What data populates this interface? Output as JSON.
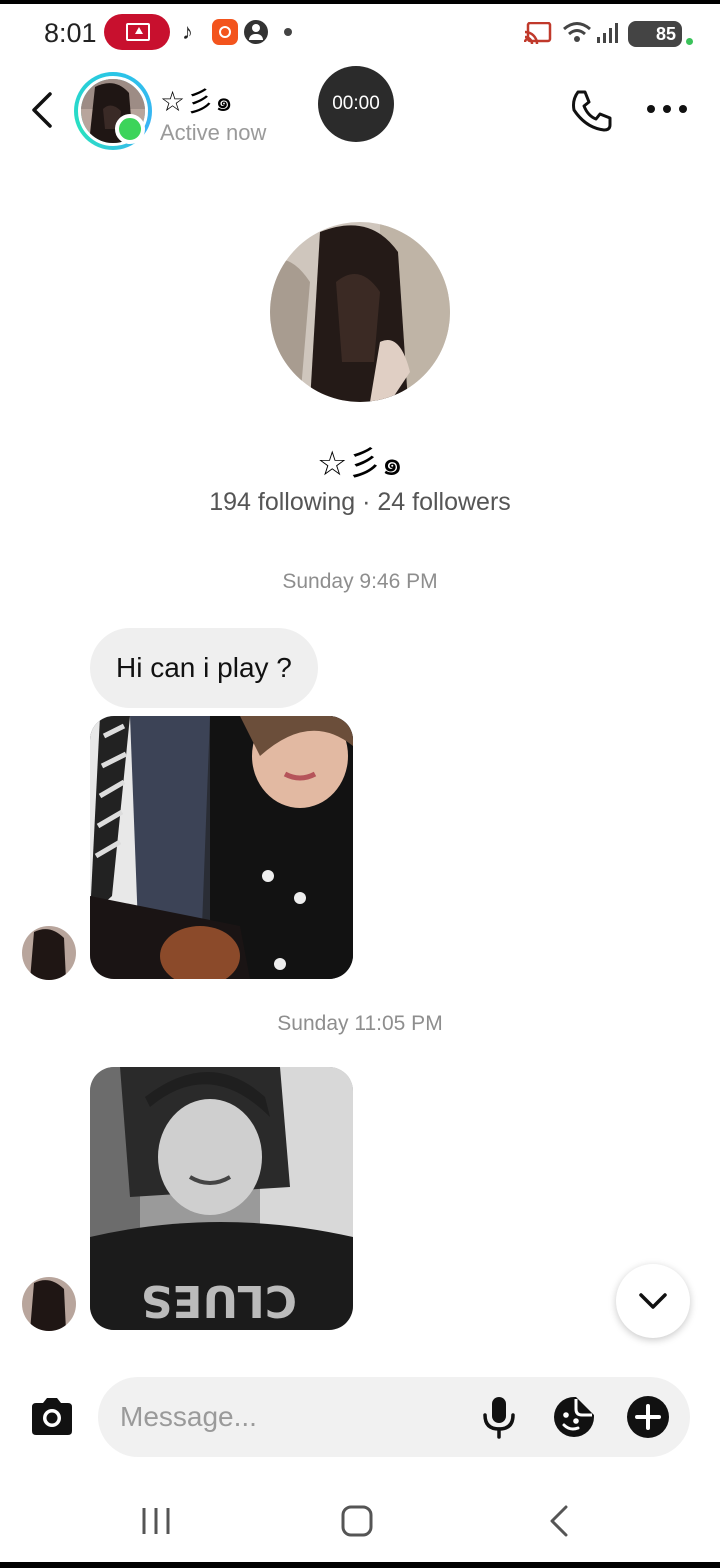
{
  "status_bar": {
    "time": "8:01",
    "battery": "85",
    "icons": [
      "screen-record-icon",
      "tiktok-icon",
      "app-notification-icon",
      "account-icon",
      "dot-icon",
      "cast-icon",
      "wifi-icon",
      "signal-icon",
      "battery-icon"
    ]
  },
  "header": {
    "name": "☆彡๑",
    "status": "Active now",
    "call_timer": "00:00",
    "icons": [
      "back-icon",
      "phone-icon",
      "more-icon"
    ]
  },
  "profile": {
    "name": "☆彡๑",
    "stats": "194 following · 24 followers"
  },
  "thread": {
    "timestamp_1": "Sunday 9:46 PM",
    "message_1": "Hi can i play ?",
    "timestamp_2": "Sunday 11:05 PM"
  },
  "composer": {
    "placeholder": "Message...",
    "icons": [
      "camera-icon",
      "microphone-icon",
      "sticker-icon",
      "plus-icon"
    ]
  },
  "nav": {
    "icons": [
      "recents-icon",
      "home-icon",
      "nav-back-icon"
    ]
  },
  "colors": {
    "status_red": "#c8102e",
    "online_green": "#3cd45a",
    "ring_cyan": "#29c5e6",
    "bubble_gray": "#efefef",
    "timer_dark": "#2b2b2b"
  }
}
